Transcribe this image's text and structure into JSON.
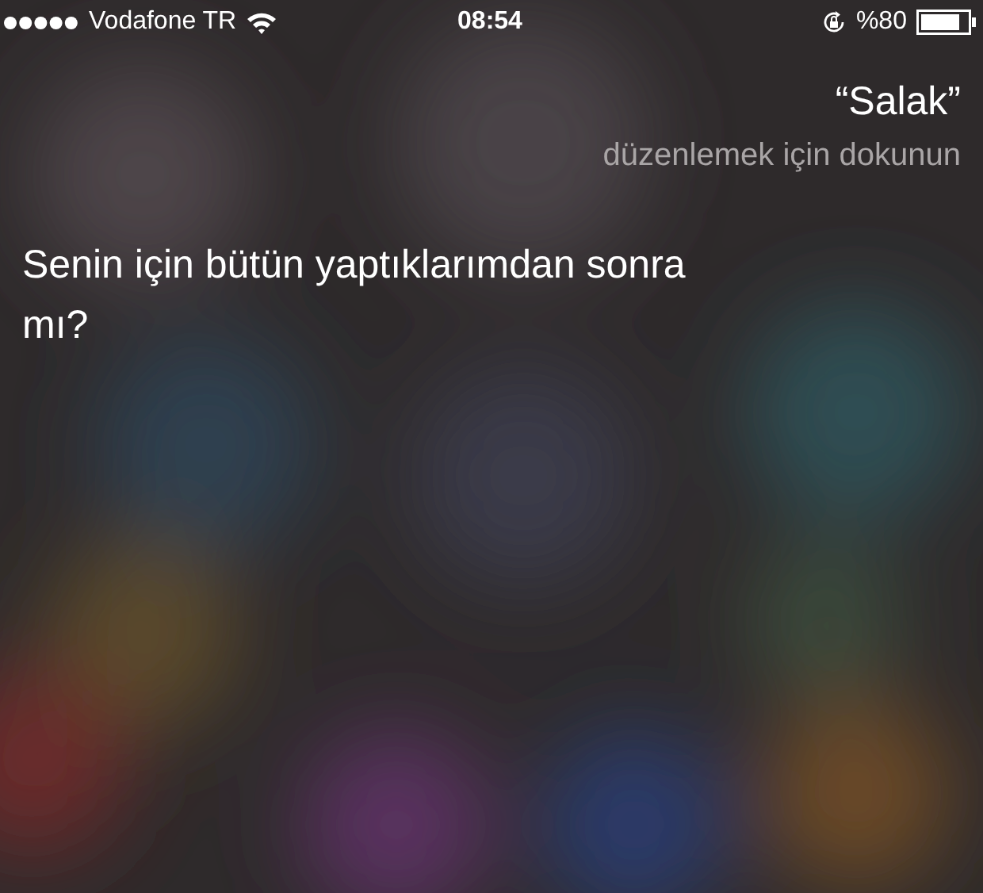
{
  "status_bar": {
    "carrier": "Vodafone TR",
    "time": "08:54",
    "battery_text": "%80"
  },
  "siri": {
    "query": "“Salak”",
    "edit_hint": "düzenlemek için dokunun",
    "response": "Senin için bütün yaptıklarımdan sonra mı?"
  }
}
